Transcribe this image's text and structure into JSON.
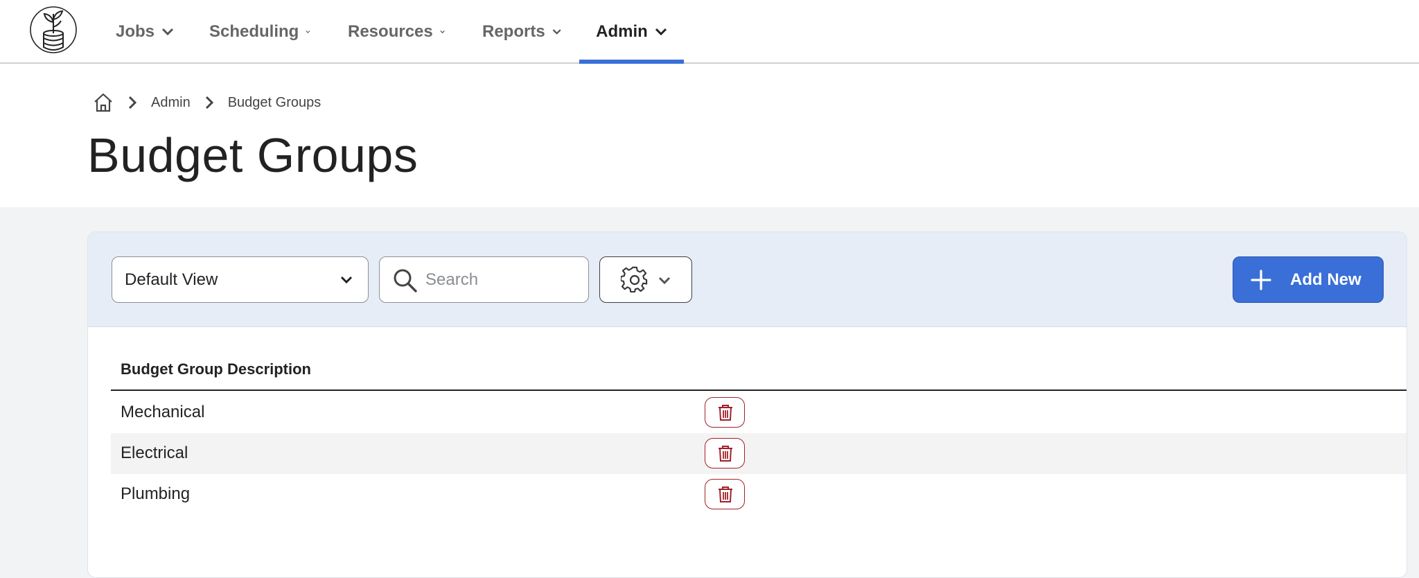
{
  "nav": {
    "items": [
      {
        "label": "Jobs"
      },
      {
        "label": "Scheduling"
      },
      {
        "label": "Resources"
      },
      {
        "label": "Reports"
      },
      {
        "label": "Admin",
        "active": true
      }
    ]
  },
  "breadcrumb": [
    "Admin",
    "Budget Groups"
  ],
  "page": {
    "title": "Budget Groups"
  },
  "toolbar": {
    "view_select": "Default View",
    "search_placeholder": "Search",
    "search_value": "",
    "add_label": "Add New"
  },
  "table": {
    "columns": [
      "Budget Group Description"
    ],
    "rows": [
      {
        "description": "Mechanical"
      },
      {
        "description": "Electrical"
      },
      {
        "description": "Plumbing"
      }
    ]
  },
  "colors": {
    "accent": "#3a6fd8",
    "toolbar_bg": "#e6edf7",
    "delete": "#a02028"
  },
  "icons": [
    "logo-icon",
    "chevron-down-icon",
    "home-icon",
    "chevron-right-icon",
    "search-icon",
    "gear-icon",
    "plus-icon",
    "trash-icon"
  ]
}
